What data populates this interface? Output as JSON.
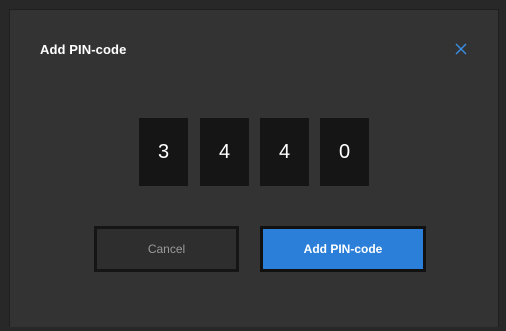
{
  "dialog": {
    "title": "Add PIN-code",
    "close_icon": "close-icon"
  },
  "pin": {
    "digits": [
      "3",
      "4",
      "4",
      "0"
    ]
  },
  "buttons": {
    "cancel_label": "Cancel",
    "confirm_label": "Add PIN-code"
  },
  "colors": {
    "accent": "#2b7fd8",
    "close_icon": "#3a8ee6",
    "dialog_bg": "#333333",
    "pin_box_bg": "#151515"
  }
}
